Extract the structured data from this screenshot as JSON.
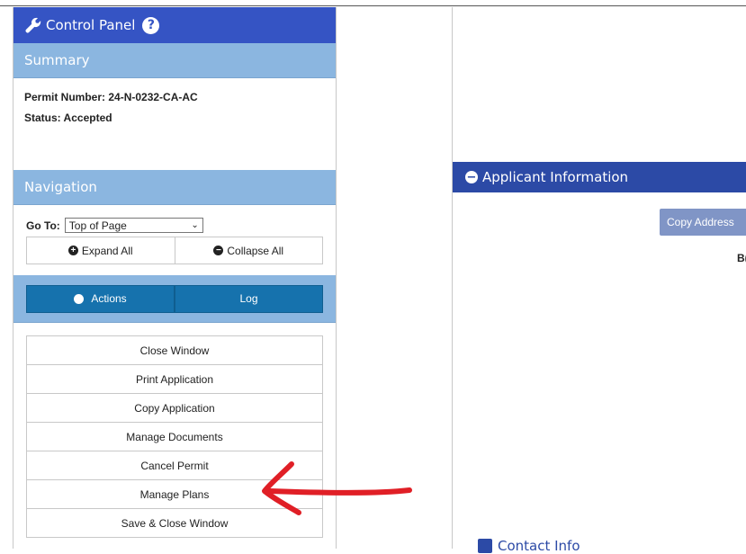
{
  "control_panel": {
    "title": "Control Panel",
    "help_glyph": "?",
    "icon": "wrench-icon",
    "accent_color": "#3554c4"
  },
  "summary": {
    "title": "Summary",
    "permit_label": "Permit Number: 24-N-0232-CA-AC",
    "status_label": "Status: Accepted"
  },
  "navigation": {
    "title": "Navigation",
    "goto_label": "Go To:",
    "goto_selected": "Top of Page",
    "expand_all": "Expand All",
    "collapse_all": "Collapse All",
    "expand_glyph": "+",
    "collapse_glyph": "−"
  },
  "tabs": {
    "actions": "Actions",
    "log": "Log"
  },
  "actions": [
    "Close Window",
    "Print Application",
    "Copy Application",
    "Manage Documents",
    "Cancel Permit",
    "Manage Plans",
    "Save & Close Window"
  ],
  "applicant": {
    "title": "Applicant Information",
    "minus_glyph": "−",
    "copy_address": "Copy Address",
    "partial_text": "B("
  },
  "contact": {
    "title": "Contact Info"
  },
  "annotation": {
    "type": "red-arrow",
    "color": "#e01f26",
    "points_to": "Manage Plans"
  }
}
